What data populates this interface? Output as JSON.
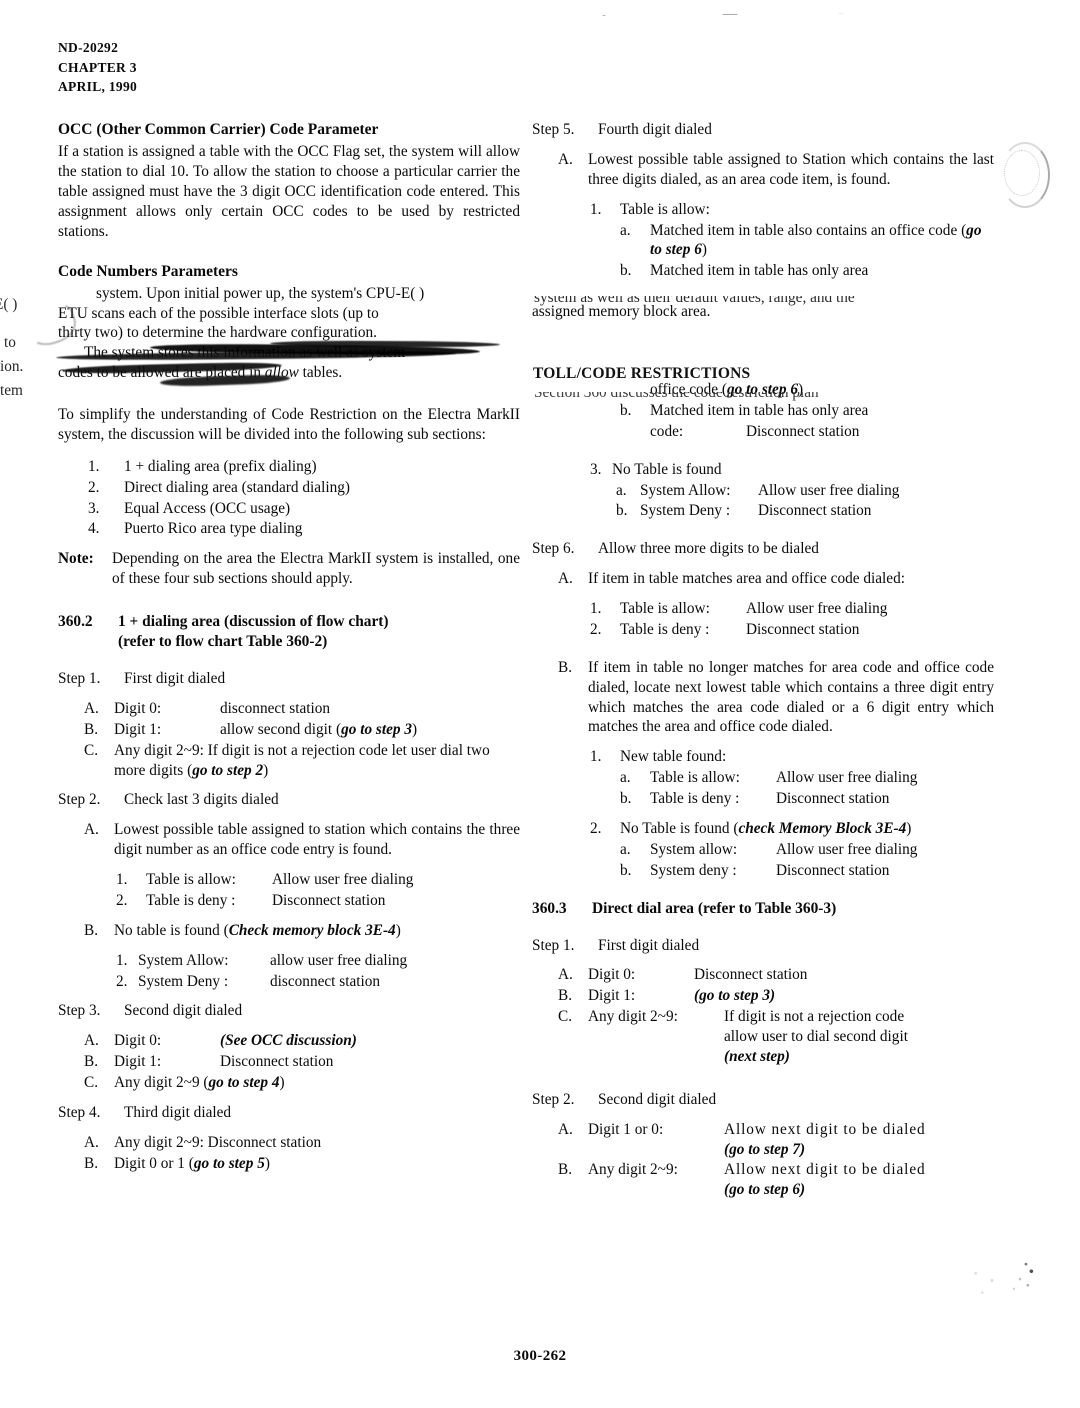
{
  "header": {
    "doc_number": "ND-20292",
    "chapter": "CHAPTER 3",
    "date": "APRIL, 1990"
  },
  "footer": {
    "page_number": "300-262"
  },
  "left_column": {
    "occ_heading": "OCC (Other Common Carrier) Code Parameter",
    "occ_paragraph": "If a station is assigned a table with the OCC Flag set, the system will allow the station to dial 10.  To allow the station to choose a particular carrier the table assigned must have the 3 digit OCC identification code entered.  This assignment allows only certain OCC codes to be used by restricted stations.",
    "code_numbers_heading": "Code Numbers Parameters",
    "smeared_line_1": "system.  Upon initial power up, the system's CPU-E( )",
    "smeared_line_2": "ETU scans each of the possible interface slots (up to",
    "smeared_line_3": "thirty two) to determine the hardware configuration.",
    "smeared_line_4": "The system stores this information as well as system",
    "smeared_line_5_pre": "codes to be allowed are placed in ",
    "smeared_line_5_ital": "allow",
    "smeared_line_5_post": " tables.",
    "simplify_paragraph": "To simplify the understanding of Code Restriction on the Electra MarkII system, the discussion will be divided into the following sub sections:",
    "sub_sections": [
      {
        "marker": "1.",
        "text": "1 + dialing area (prefix dialing)"
      },
      {
        "marker": "2.",
        "text": "Direct dialing area (standard dialing)"
      },
      {
        "marker": "3.",
        "text": "Equal Access (OCC usage)"
      },
      {
        "marker": "4.",
        "text": "Puerto Rico area type dialing"
      }
    ],
    "note_marker": "Note:",
    "note_text": "Depending on the area the Electra MarkII system is installed, one of these four sub sections should apply.",
    "section_360_2": {
      "number": "360.2",
      "title_line1": "1 + dialing area (discussion of flow chart)",
      "title_line2": "(refer to flow chart Table 360-2)"
    },
    "step1": {
      "marker": "Step 1.",
      "title": "First digit dialed",
      "items": [
        {
          "marker": "A.",
          "key": "Digit 0:",
          "value": "disconnect station"
        },
        {
          "marker": "B.",
          "key": "Digit 1:",
          "value_pre": "allow second digit (",
          "value_ital": "go to step 3",
          "value_post": ")"
        },
        {
          "marker": "C.",
          "text_pre": "Any digit 2~9:  If digit is not a rejection code let user dial two more digits (",
          "text_ital": "go to step 2",
          "text_post": ")"
        }
      ]
    },
    "step2": {
      "marker": "Step 2.",
      "title": "Check last 3 digits dialed",
      "item_a": {
        "marker": "A.",
        "text": "Lowest possible table assigned to station which contains the three digit number as an office code entry is found.",
        "subitems": [
          {
            "marker": "1.",
            "key": "Table is allow:",
            "value": "Allow user free dialing"
          },
          {
            "marker": "2.",
            "key": "Table is deny :",
            "value": "Disconnect station"
          }
        ]
      },
      "item_b": {
        "marker": "B.",
        "text_pre": "No table is found (",
        "text_ital": "Check memory block 3E-4",
        "text_post": ")",
        "subitems": [
          {
            "marker": "1.",
            "key": "System Allow:",
            "value": "allow user free dialing"
          },
          {
            "marker": "2.",
            "key": "System Deny :",
            "value": "disconnect station"
          }
        ]
      }
    },
    "step3": {
      "marker": "Step 3.",
      "title": "Second digit dialed",
      "items": [
        {
          "marker": "A.",
          "key": "Digit 0:",
          "value_ital": "(See OCC discussion)"
        },
        {
          "marker": "B.",
          "key": "Digit 1:",
          "value": "Disconnect station"
        },
        {
          "marker": "C.",
          "text_pre": "Any digit 2~9 (",
          "text_ital": "go to step 4",
          "text_post": ")"
        }
      ]
    },
    "step4": {
      "marker": "Step 4.",
      "title": "Third digit dialed",
      "items": [
        {
          "marker": "A.",
          "text": "Any digit 2~9:  Disconnect station"
        },
        {
          "marker": "B.",
          "text_pre": "Digit 0 or 1 (",
          "text_ital": "go to step 5",
          "text_post": ")"
        }
      ]
    }
  },
  "right_column": {
    "step5": {
      "marker": "Step 5.",
      "title": "Fourth digit dialed",
      "item_a": {
        "marker": "A.",
        "text": "Lowest possible table assigned to Station which contains the last three digits dialed, as an area code item, is found.",
        "sub1": {
          "marker": "1.",
          "title": "Table is allow:",
          "letters": [
            {
              "marker": "a.",
              "text_pre": "Matched item in table also contains an office code (",
              "text_ital": "go to step 6",
              "text_post": ")"
            },
            {
              "marker": "b.",
              "text": "Matched item in table has only area"
            }
          ]
        }
      },
      "occluded_continuation": "assigned memory block area.",
      "sub_after_ghost": {
        "letters": [
          {
            "marker": "",
            "text_pre": "office code (",
            "text_ital": "go to step 6",
            "text_post": ")"
          },
          {
            "marker": "b.",
            "text": "Matched item in table has only area",
            "key2": "code:",
            "value2": "Disconnect station"
          }
        ]
      },
      "sub3": {
        "marker": "3.",
        "title": "No Table is found",
        "letters": [
          {
            "marker": "a.",
            "key": "System Allow:",
            "value": "Allow user free dialing"
          },
          {
            "marker": "b.",
            "key": "System Deny :",
            "value": "Disconnect station"
          }
        ]
      }
    },
    "ghost_text": {
      "line1": "system as well as their default values, range, and the",
      "line2_left": "E( )",
      "line3_left": "to",
      "line4_left": "ion.",
      "line5_left": "tem",
      "toll_heading": "TOLL/CODE RESTRICTIONS",
      "toll_line": "Section  360  discusses  the  code  restriction  plan"
    },
    "step6": {
      "marker": "Step 6.",
      "title": "Allow three more digits to be dialed",
      "item_a": {
        "marker": "A.",
        "text": "If item in table matches area and office code dialed:",
        "subitems": [
          {
            "marker": "1.",
            "key": "Table is allow:",
            "value": "Allow user free dialing"
          },
          {
            "marker": "2.",
            "key": "Table is deny :",
            "value": "Disconnect station"
          }
        ]
      },
      "item_b": {
        "marker": "B.",
        "text": "If item in table no longer matches for area code and office code dialed, locate next lowest table which contains a three digit entry which matches the area code dialed or a 6 digit entry which matches the area and office code dialed.",
        "sub1": {
          "marker": "1.",
          "title": "New table found:",
          "letters": [
            {
              "marker": "a.",
              "key": "Table is allow:",
              "value": "Allow user free dialing"
            },
            {
              "marker": "b.",
              "key": "Table is deny :",
              "value": "Disconnect station"
            }
          ]
        },
        "sub2": {
          "marker": "2.",
          "title_pre": "No Table is found (",
          "title_ital": "check Memory Block 3E-4",
          "title_post": ")",
          "letters": [
            {
              "marker": "a.",
              "key": "System allow:",
              "value": "Allow user free dialing"
            },
            {
              "marker": "b.",
              "key": "System deny :",
              "value": "Disconnect station"
            }
          ]
        }
      }
    },
    "section_360_3": {
      "number": "360.3",
      "title": "Direct dial area  (refer to Table 360-3)"
    },
    "step1": {
      "marker": "Step 1.",
      "title": "First digit dialed",
      "items": [
        {
          "marker": "A.",
          "key": "Digit 0:",
          "value": "Disconnect station"
        },
        {
          "marker": "B.",
          "key": "Digit 1:",
          "value_ital": "(go to step 3)"
        },
        {
          "marker": "C.",
          "key": "Any digit 2~9:",
          "value_l1": "If digit is not a rejection code",
          "value_l2": "allow user to dial second digit",
          "value_l3_ital": "(next step)"
        }
      ]
    },
    "step2": {
      "marker": "Step 2.",
      "title": "Second digit dialed",
      "items": [
        {
          "marker": "A.",
          "key": "Digit 1 or 0:",
          "value_l1": "Allow next digit to be dialed",
          "value_l2_ital": "(go to step 7)"
        },
        {
          "marker": "B.",
          "key": "Any digit 2~9:",
          "value_l1": "Allow next digit to be dialed",
          "value_l2_ital": "(go to step 6)"
        }
      ]
    }
  }
}
